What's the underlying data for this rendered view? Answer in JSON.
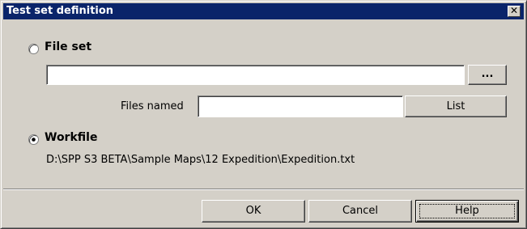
{
  "window": {
    "title": "Test set definition",
    "close_glyph": "✕"
  },
  "file_set": {
    "label": "File set",
    "selected": false,
    "path_value": "",
    "browse_label": "...",
    "files_named_label": "Files named",
    "files_named_value": "",
    "list_label": "List"
  },
  "workfile": {
    "label": "Workfile",
    "selected": true,
    "path": "D:\\SPP S3 BETA\\Sample Maps\\12 Expedition\\Expedition.txt"
  },
  "buttons": {
    "ok_label": "OK",
    "cancel_label": "Cancel",
    "help_label": "Help"
  },
  "colors": {
    "title_bar": "#0a246a",
    "dialog_face": "#d4d0c8"
  }
}
